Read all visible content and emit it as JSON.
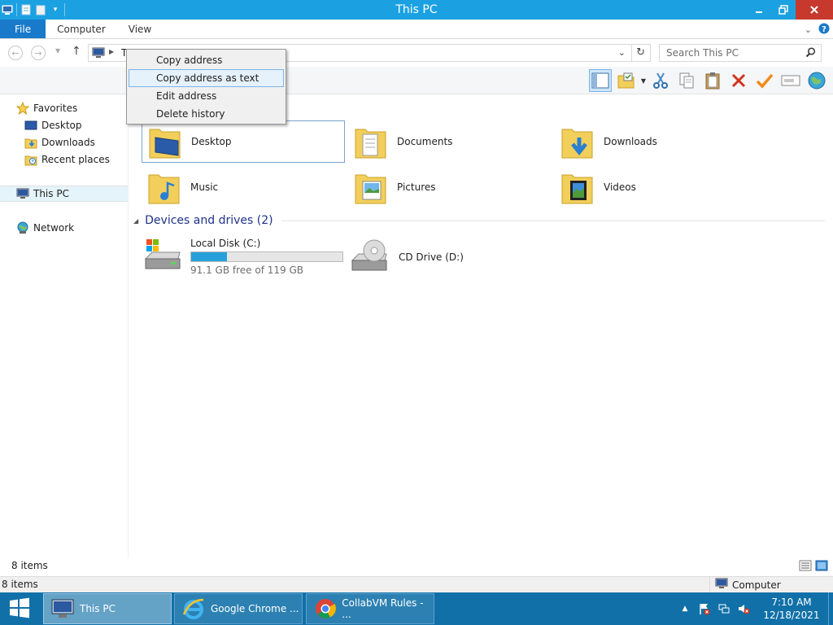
{
  "window": {
    "title": "This PC"
  },
  "ribbon": {
    "tabs": [
      {
        "label": "File"
      },
      {
        "label": "Computer"
      },
      {
        "label": "View"
      }
    ]
  },
  "address": {
    "path_fragment": "T",
    "search_placeholder": "Search This PC"
  },
  "context_menu": {
    "items": [
      {
        "label": "Copy address"
      },
      {
        "label": "Copy address as text"
      },
      {
        "label": "Edit address"
      },
      {
        "label": "Delete history"
      }
    ],
    "highlighted_index": 1
  },
  "navigation": {
    "favorites": {
      "label": "Favorites",
      "items": [
        {
          "label": "Desktop"
        },
        {
          "label": "Downloads"
        },
        {
          "label": "Recent places"
        }
      ]
    },
    "this_pc": {
      "label": "This PC"
    },
    "network": {
      "label": "Network"
    }
  },
  "folders": [
    {
      "label": "Desktop",
      "icon": "desktop-folder-icon"
    },
    {
      "label": "Documents",
      "icon": "documents-folder-icon"
    },
    {
      "label": "Downloads",
      "icon": "downloads-folder-icon"
    },
    {
      "label": "Music",
      "icon": "music-folder-icon"
    },
    {
      "label": "Pictures",
      "icon": "pictures-folder-icon"
    },
    {
      "label": "Videos",
      "icon": "videos-folder-icon"
    }
  ],
  "devices": {
    "header": "Devices and drives (2)",
    "drives": [
      {
        "label": "Local Disk (C:)",
        "free_text": "91.1 GB free of 119 GB",
        "used_fraction": 0.234
      },
      {
        "label": "CD Drive (D:)"
      }
    ]
  },
  "status": {
    "item_count": "8 items",
    "details_count": "8 items",
    "details_location": "Computer"
  },
  "taskbar": {
    "buttons": [
      {
        "label": "This PC",
        "active": true
      },
      {
        "label": "Google Chrome ...",
        "active": false
      },
      {
        "label": "CollabVM Rules - ...",
        "active": false
      }
    ],
    "clock": {
      "time": "7:10 AM",
      "date": "12/18/2021"
    }
  },
  "colors": {
    "titlebar": "#1ba1e2",
    "file_tab": "#1979ca",
    "taskbar": "#1170a8",
    "close_button": "#c7392c",
    "group_header": "#1e3287",
    "drive_fill": "#26a0da"
  }
}
